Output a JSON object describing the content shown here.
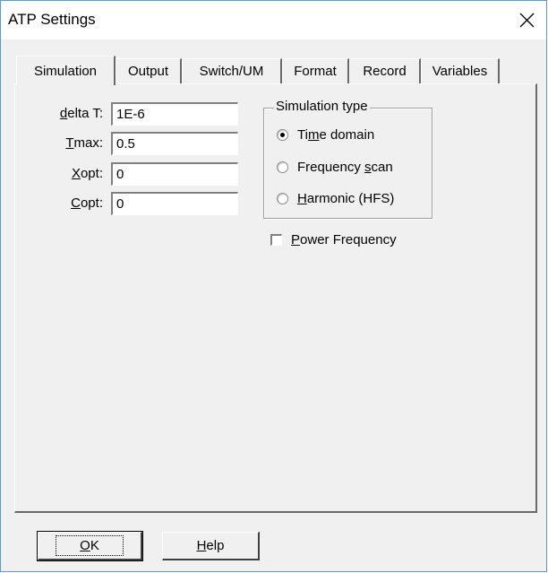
{
  "window": {
    "title": "ATP Settings",
    "close_icon": "close-icon"
  },
  "tabs": [
    {
      "label": "Simulation",
      "active": true
    },
    {
      "label": "Output",
      "active": false
    },
    {
      "label": "Switch/UM",
      "active": false
    },
    {
      "label": "Format",
      "active": false
    },
    {
      "label": "Record",
      "active": false
    },
    {
      "label": "Variables",
      "active": false
    }
  ],
  "fields": {
    "delta_t": {
      "label_accel": "d",
      "label_rest": "elta T:",
      "value": "1E-6"
    },
    "tmax": {
      "label_accel": "T",
      "label_rest": "max:",
      "value": "0.5"
    },
    "xopt": {
      "label_accel": "X",
      "label_rest": "opt:",
      "value": "0"
    },
    "copt": {
      "label_accel": "C",
      "label_rest": "opt:",
      "value": "0"
    }
  },
  "simulation_type": {
    "title": "Simulation type",
    "options": [
      {
        "pre": "Ti",
        "accel": "m",
        "post": "e domain",
        "checked": true
      },
      {
        "pre": "Frequency ",
        "accel": "s",
        "post": "can",
        "checked": false
      },
      {
        "pre": "",
        "accel": "H",
        "post": "armonic (HFS)",
        "checked": false
      }
    ]
  },
  "power_frequency": {
    "accel": "P",
    "rest": "ower Frequency",
    "checked": false
  },
  "buttons": {
    "ok": {
      "accel": "O",
      "rest": "K"
    },
    "help": {
      "accel": "H",
      "rest": "elp"
    }
  }
}
